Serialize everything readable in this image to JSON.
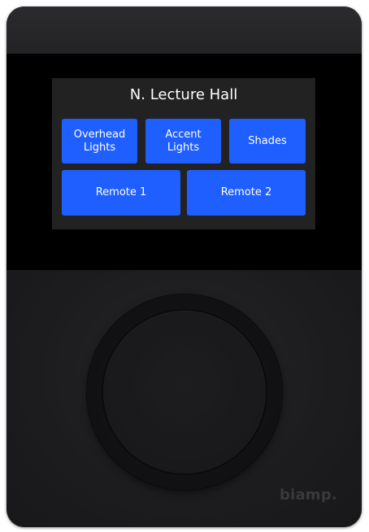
{
  "display": {
    "room_title": "N. Lecture Hall",
    "buttons": [
      {
        "label": "Overhead\nLights"
      },
      {
        "label": "Accent\nLights"
      },
      {
        "label": "Shades"
      },
      {
        "label": "Remote 1"
      },
      {
        "label": "Remote 2"
      }
    ]
  },
  "device": {
    "brand": "biamp."
  },
  "colors": {
    "button_blue": "#1f5fff",
    "screen_bg": "#222222",
    "device_body": "#1c1c1e"
  }
}
